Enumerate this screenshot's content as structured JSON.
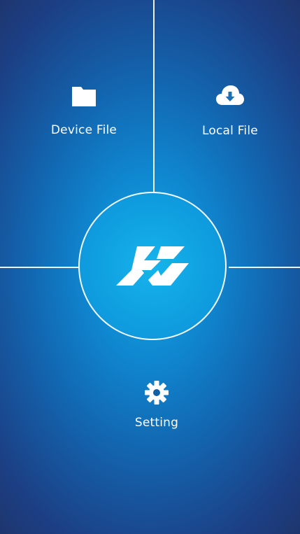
{
  "tiles": {
    "device_file": {
      "label": "Device File",
      "icon": "folder-icon"
    },
    "local_file": {
      "label": "Local File",
      "icon": "cloud-download-icon"
    },
    "setting": {
      "label": "Setting",
      "icon": "gear-icon"
    }
  },
  "center": {
    "icon": "app-logo-icon"
  },
  "colors": {
    "background_center": "#12a8e6",
    "background_edge": "#1e366f",
    "foreground": "#ffffff"
  }
}
